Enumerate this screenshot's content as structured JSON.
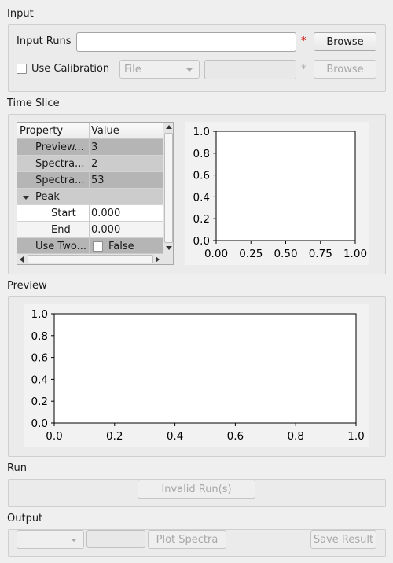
{
  "input": {
    "section_title": "Input",
    "input_runs_label": "Input Runs",
    "input_runs_value": "",
    "required_marker": "*",
    "browse_label": "Browse",
    "use_calibration_label": "Use Calibration",
    "use_calibration_checked": false,
    "calibration_type": "File",
    "calibration_value": "",
    "calibration_required_marker": "*",
    "calibration_browse_label": "Browse"
  },
  "time_slice": {
    "section_title": "Time Slice",
    "table": {
      "headers": [
        "Property",
        "Value"
      ],
      "rows": [
        {
          "property": "Preview...",
          "value": "3"
        },
        {
          "property": "Spectra...",
          "value": "2"
        },
        {
          "property": "Spectra...",
          "value": "53"
        },
        {
          "property": "Peak",
          "value": ""
        },
        {
          "property": "Start",
          "value": "0.000"
        },
        {
          "property": "End",
          "value": "0.000"
        },
        {
          "property": "Use Two...",
          "value": "False"
        }
      ]
    },
    "plot": {
      "x_ticks": [
        "0.00",
        "0.25",
        "0.50",
        "0.75",
        "1.00"
      ],
      "y_ticks": [
        "0.0",
        "0.2",
        "0.4",
        "0.6",
        "0.8",
        "1.0"
      ]
    }
  },
  "preview": {
    "section_title": "Preview",
    "plot": {
      "x_ticks": [
        "0.0",
        "0.2",
        "0.4",
        "0.6",
        "0.8",
        "1.0"
      ],
      "y_ticks": [
        "0.0",
        "0.2",
        "0.4",
        "0.6",
        "0.8",
        "1.0"
      ]
    }
  },
  "run": {
    "section_title": "Run",
    "run_button_label": "Invalid Run(s)"
  },
  "output": {
    "section_title": "Output",
    "combo_value": "",
    "field_value": "",
    "plot_spectra_label": "Plot Spectra",
    "save_result_label": "Save Result"
  },
  "colors": {
    "window_bg": "#efefef",
    "required_star": "#cc0000",
    "row_dark": "#b5b5b5",
    "row_light": "#cccccc",
    "disabled_text": "#a7a7a7"
  }
}
